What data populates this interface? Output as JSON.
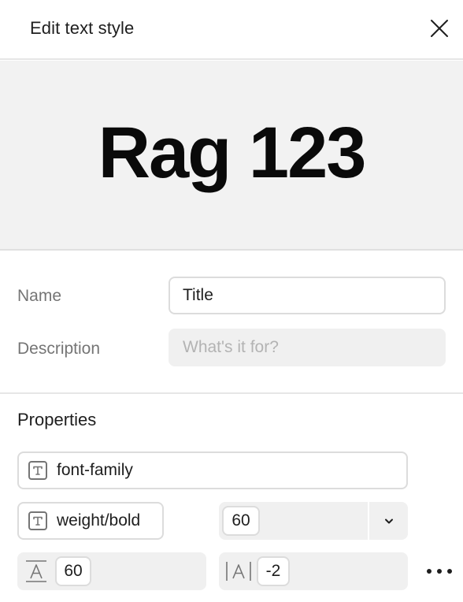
{
  "dialog": {
    "title": "Edit text style",
    "close_icon": "close-icon"
  },
  "preview": {
    "sample_text": "Rag 123"
  },
  "form": {
    "name_label": "Name",
    "name_value": "Title",
    "description_label": "Description",
    "description_placeholder": "What's it for?"
  },
  "properties": {
    "title": "Properties",
    "font_family": {
      "icon": "text-icon",
      "value": "font-family"
    },
    "font_weight": {
      "icon": "text-icon",
      "value": "weight/bold"
    },
    "font_size": {
      "value": "60",
      "dropdown_icon": "chevron-down-icon"
    },
    "line_height": {
      "icon": "line-height-icon",
      "value": "60"
    },
    "letter_spacing": {
      "icon": "letter-spacing-icon",
      "value": "-2"
    },
    "more_icon": "more-icon"
  },
  "colors": {
    "preview_bg": "#f2f2f2",
    "field_bg": "#f0f0f0",
    "border": "#dcdcdc",
    "label": "#757575",
    "text": "#1e1e1e"
  }
}
